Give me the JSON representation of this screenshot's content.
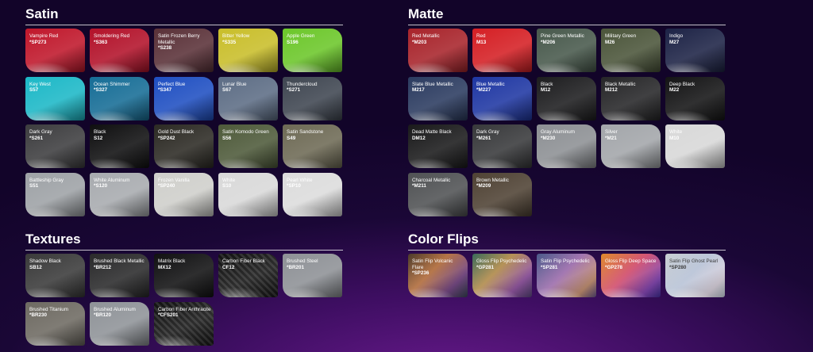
{
  "sections": {
    "satin": {
      "title": "Satin",
      "swatches": [
        {
          "name": "Vampire Red",
          "code": "*SP273",
          "color": "#c0172b"
        },
        {
          "name": "Smoldering Red",
          "code": "*S363",
          "color": "#b3122a"
        },
        {
          "name": "Satin Frozen Berry Metallic",
          "code": "*S238",
          "color": "#5a3138"
        },
        {
          "name": "Bitter Yellow",
          "code": "*S335",
          "color": "#c9be2a"
        },
        {
          "name": "Apple Green",
          "code": "S196",
          "color": "#6cc72a"
        },
        {
          "name": "Key West",
          "code": "S57",
          "color": "#1cb8c7"
        },
        {
          "name": "Ocean Shimmer",
          "code": "*S327",
          "color": "#166d96"
        },
        {
          "name": "Perfect Blue",
          "code": "*S347",
          "color": "#1f4fc2"
        },
        {
          "name": "Lunar Blue",
          "code": "S67",
          "color": "#5d6d85"
        },
        {
          "name": "Thundercloud",
          "code": "*S271",
          "color": "#3f4651"
        },
        {
          "name": "Dark Gray",
          "code": "*S261",
          "color": "#3d3d3f"
        },
        {
          "name": "Black",
          "code": "S12",
          "color": "#0f0f10"
        },
        {
          "name": "Gold Dust Black",
          "code": "*SP242",
          "color": "#2c2a24"
        },
        {
          "name": "Satin Komodo Green",
          "code": "S56",
          "color": "#4e5a3a"
        },
        {
          "name": "Satin Sandstone",
          "code": "S49",
          "color": "#6e6a55"
        },
        {
          "name": "Battleship Gray",
          "code": "S51",
          "color": "#9ea2a6"
        },
        {
          "name": "White Aluminum",
          "code": "*S120",
          "color": "#a8abaf"
        },
        {
          "name": "Frozen Vanilla",
          "code": "*SP240",
          "color": "#cfcfcb"
        },
        {
          "name": "White",
          "code": "S10",
          "color": "#d9d9d9"
        },
        {
          "name": "Pearl White",
          "code": "*SP10",
          "color": "#dcdcdc"
        }
      ]
    },
    "matte": {
      "title": "Matte",
      "swatches": [
        {
          "name": "Red Metallic",
          "code": "*M203",
          "color": "#a8242b"
        },
        {
          "name": "Red",
          "code": "M13",
          "color": "#d51f24"
        },
        {
          "name": "Pine Green Metallic",
          "code": "*M206",
          "color": "#48594c"
        },
        {
          "name": "Military Green",
          "code": "M26",
          "color": "#4b553a"
        },
        {
          "name": "Indigo",
          "code": "M27",
          "color": "#1d2346"
        },
        {
          "name": "Slate Blue Metallic",
          "code": "M217",
          "color": "#2b3b60"
        },
        {
          "name": "Blue Metallic",
          "code": "*M227",
          "color": "#1f37a3"
        },
        {
          "name": "Black",
          "code": "M12",
          "color": "#1d1d1f"
        },
        {
          "name": "Black Metallic",
          "code": "M212",
          "color": "#262628"
        },
        {
          "name": "Deep Black",
          "code": "M22",
          "color": "#141415"
        },
        {
          "name": "Dead Matte Black",
          "code": "DM12",
          "color": "#1a1a1b"
        },
        {
          "name": "Dark Gray",
          "code": "*M261",
          "color": "#38393b"
        },
        {
          "name": "Gray Aluminum",
          "code": "*M230",
          "color": "#8d9094"
        },
        {
          "name": "Silver",
          "code": "*M21",
          "color": "#a3a6aa"
        },
        {
          "name": "White",
          "code": "M10",
          "color": "#d8d8d8"
        },
        {
          "name": "Charcoal Metallic",
          "code": "*M211",
          "color": "#505254"
        },
        {
          "name": "Brown Metallic",
          "code": "*M209",
          "color": "#4f4234"
        }
      ]
    },
    "textures": {
      "title": "Textures",
      "swatches": [
        {
          "name": "Shadow Black",
          "code": "SB12",
          "color": "#3a3a3a"
        },
        {
          "name": "Brushed Black Metallic",
          "code": "*BR212",
          "color": "#2a2a2b"
        },
        {
          "name": "Matrix Black",
          "code": "MX12",
          "color": "#111112"
        },
        {
          "name": "Carbon Fiber Black",
          "code": "CF12",
          "color": "#181818",
          "texture": "carbon"
        },
        {
          "name": "Brushed Steel",
          "code": "*BR201",
          "color": "#8e9196"
        },
        {
          "name": "Brushed Titanium",
          "code": "*BR230",
          "color": "#6e6a62"
        },
        {
          "name": "Brushed Aluminum",
          "code": "*BR120",
          "color": "#8f9398"
        },
        {
          "name": "Carbon Fiber Anthracite",
          "code": "*CFS201",
          "color": "#4a4b4d",
          "texture": "carbon"
        }
      ]
    },
    "colorflips": {
      "title": "Color Flips",
      "swatches": [
        {
          "name": "Satin Flip Volcanic Flare",
          "code": "*SP236",
          "color": "#7a4a3a",
          "gradient": "linear-gradient(135deg,#4b3a2a 0%,#b06b3a 40%,#6a3a7a 75%,#2f3a4a 100%)"
        },
        {
          "name": "Gloss Flip Psychedelic",
          "code": "*GP281",
          "color": "#6a5a8a",
          "gradient": "linear-gradient(135deg,#3a6a5a 0%,#b08a4a 40%,#8a4a9a 75%,#4a3a6a 100%)"
        },
        {
          "name": "Satin Flip Psychedelic",
          "code": "*SP281",
          "color": "#7a5a9a",
          "gradient": "linear-gradient(135deg,#4a5a8a 0%,#9a6aaa 45%,#c08a6a 80%,#5a4a7a 100%)"
        },
        {
          "name": "Gloss Flip Deep Space",
          "code": "*GP278",
          "color": "#c0543a",
          "gradient": "linear-gradient(135deg,#e08a2a 0%,#d04a6a 45%,#7a3aaa 80%,#3a2a8a 100%)"
        },
        {
          "name": "Satin Flip Ghost Pearl",
          "code": "*SP280",
          "color": "#bfc6cc",
          "gradient": "linear-gradient(135deg,#c8cdd2 0%,#b7c2d6 45%,#d8d0dc 80%,#aeb8c2 100%)",
          "dark_text": true
        }
      ]
    }
  }
}
